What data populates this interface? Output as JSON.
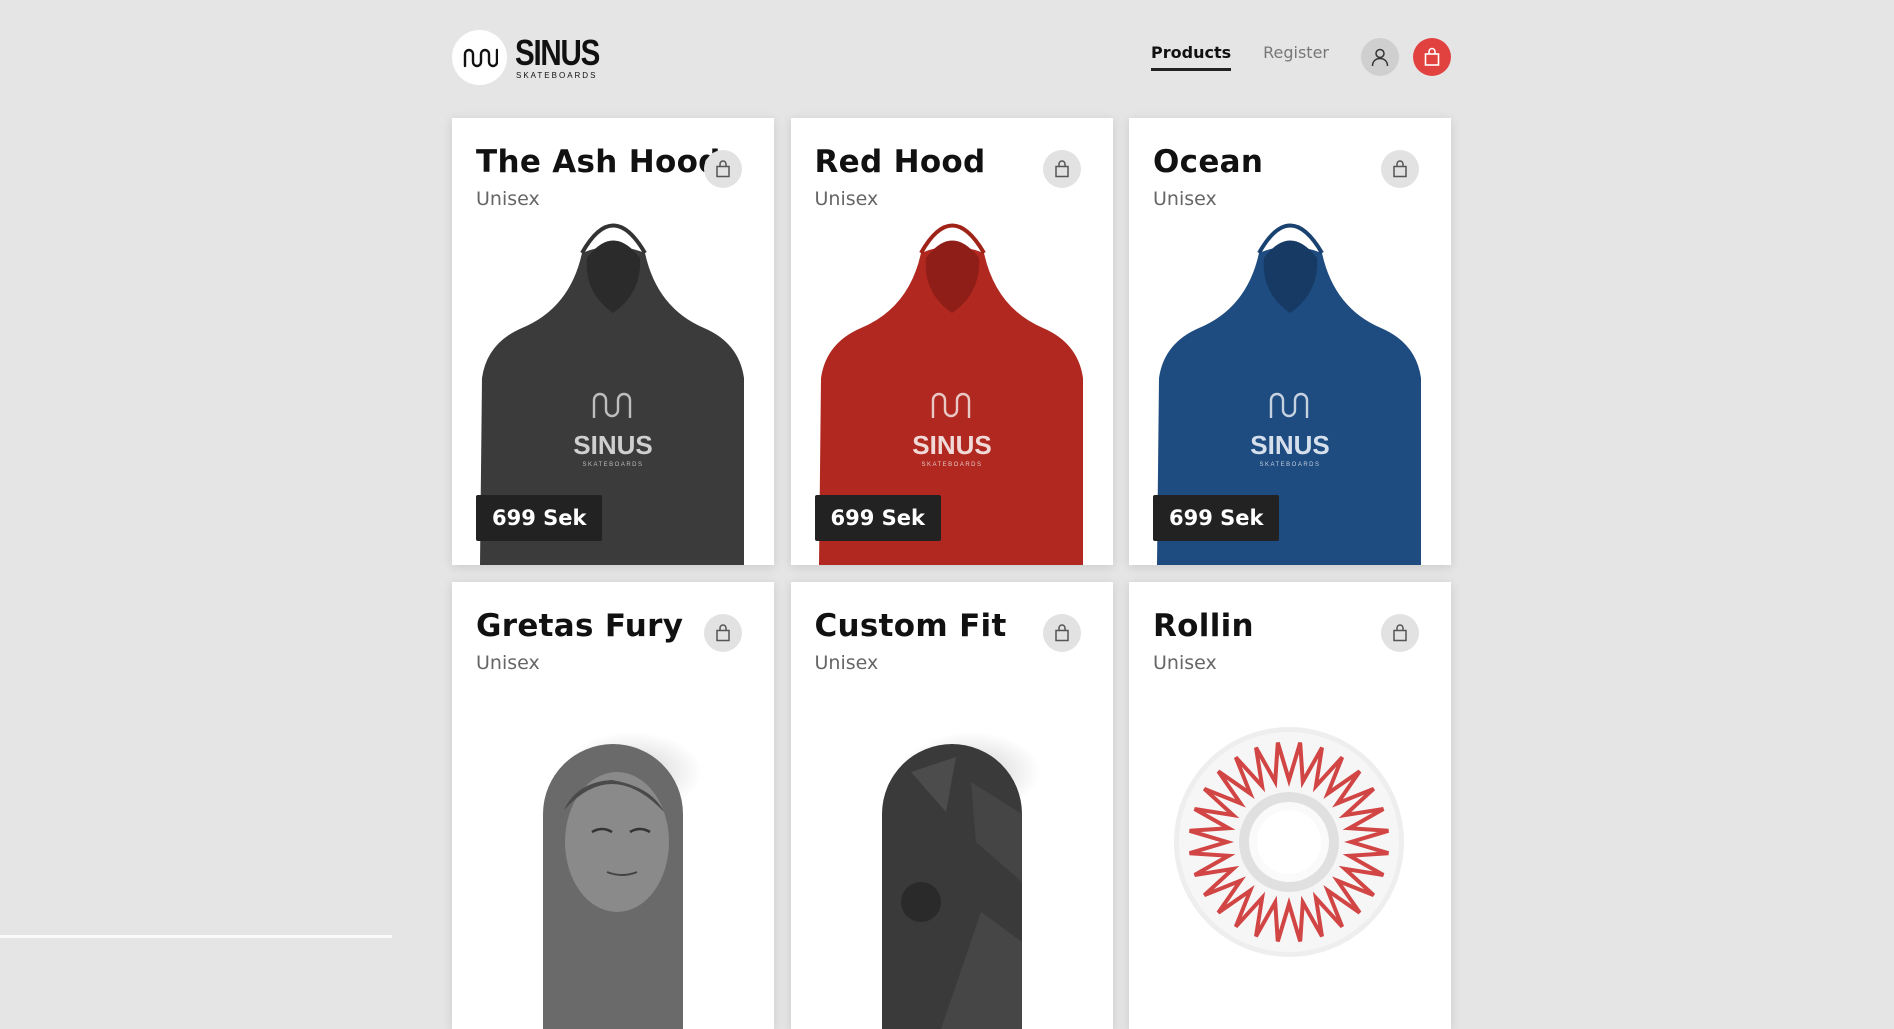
{
  "brand": {
    "name": "SINUS",
    "tagline": "SKATEBOARDS"
  },
  "nav": {
    "products": "Products",
    "register": "Register"
  },
  "products": [
    {
      "title": "The Ash Hood",
      "category": "Unisex",
      "price": "699 Sek",
      "color": "#3b3b3b"
    },
    {
      "title": "Red Hood",
      "category": "Unisex",
      "price": "699 Sek",
      "color": "#b0281f"
    },
    {
      "title": "Ocean",
      "category": "Unisex",
      "price": "699 Sek",
      "color": "#1e4b80"
    },
    {
      "title": "Gretas Fury",
      "category": "Unisex"
    },
    {
      "title": "Custom Fit",
      "category": "Unisex"
    },
    {
      "title": "Rollin",
      "category": "Unisex"
    }
  ],
  "colors": {
    "accent": "#e1423f",
    "price_bg": "#222222",
    "background": "#e5e5e5"
  },
  "icons": {
    "user": "user-icon",
    "bag": "shopping-bag-icon",
    "add": "bag-icon"
  }
}
